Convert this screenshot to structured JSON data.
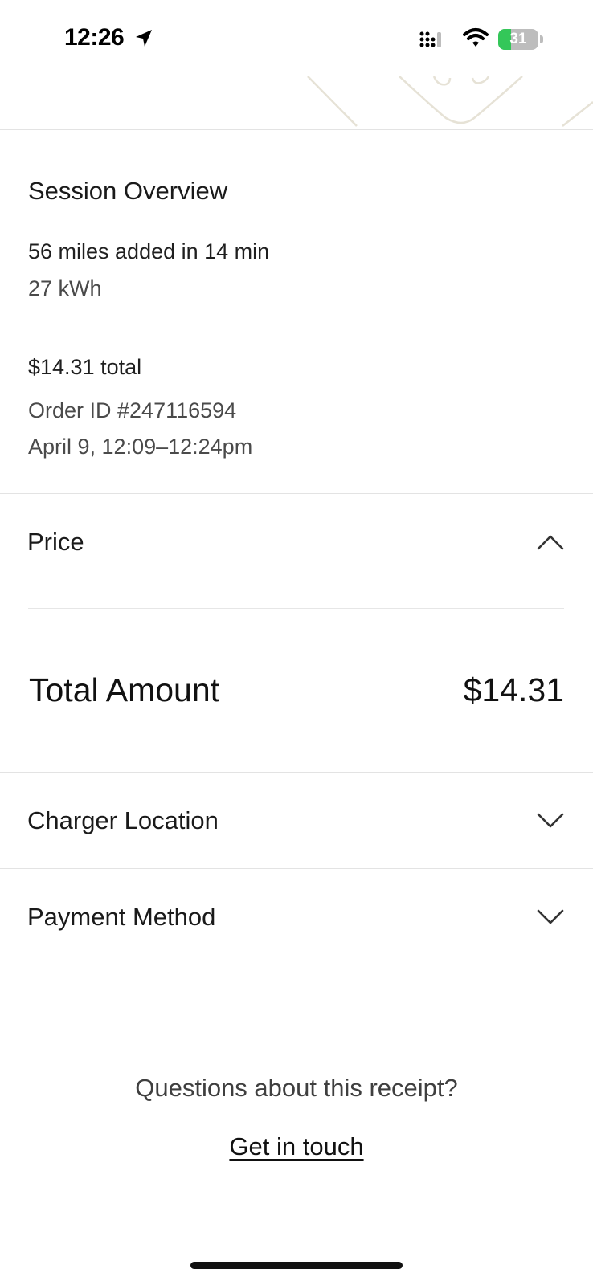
{
  "status_bar": {
    "time": "12:26",
    "battery_percent": "31",
    "battery_level": 0.31,
    "icons": [
      "location-arrow-icon",
      "cellular-signal-icon",
      "wifi-icon",
      "battery-charging-icon"
    ]
  },
  "overview": {
    "title": "Session Overview",
    "miles_added": "56 miles added in 14 min",
    "energy": "27 kWh",
    "total_line": "$14.31 total",
    "order_id": "Order ID #247116594",
    "date_time": "April 9,  12:09–12:24pm"
  },
  "price_section": {
    "label": "Price",
    "expanded": true,
    "total_label": "Total Amount",
    "total_value": "$14.31"
  },
  "charger_location": {
    "label": "Charger Location",
    "expanded": false
  },
  "payment_method": {
    "label": "Payment Method",
    "expanded": false
  },
  "footer": {
    "question": "Questions about this receipt?",
    "link": "Get in touch"
  },
  "colors": {
    "battery_green": "#34c759",
    "divider": "#e3e3e3",
    "header_art_stroke": "#e6e2d6"
  }
}
